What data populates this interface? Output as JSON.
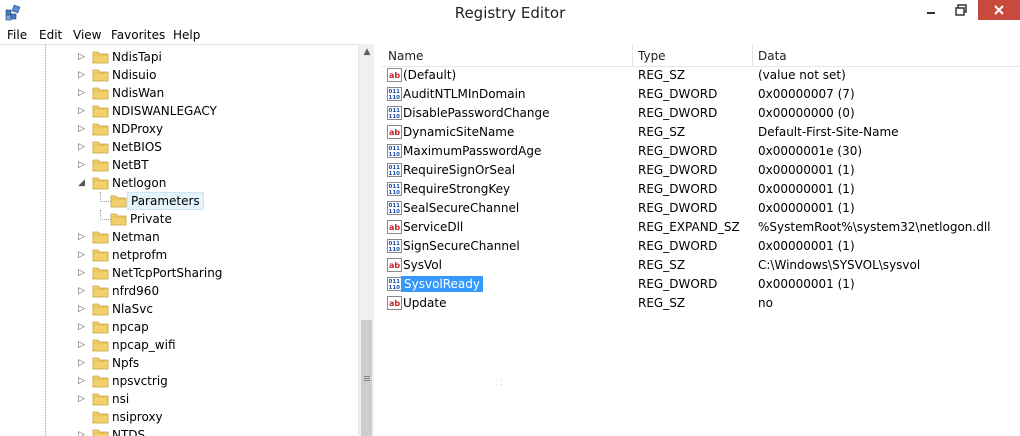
{
  "window": {
    "title": "Registry Editor"
  },
  "menu": [
    "File",
    "Edit",
    "View",
    "Favorites",
    "Help"
  ],
  "tree": [
    {
      "label": "NdisTapi",
      "expand": "▷"
    },
    {
      "label": "Ndisuio",
      "expand": "▷"
    },
    {
      "label": "NdisWan",
      "expand": "▷"
    },
    {
      "label": "NDISWANLEGACY",
      "expand": "▷"
    },
    {
      "label": "NDProxy",
      "expand": "▷"
    },
    {
      "label": "NetBIOS",
      "expand": "▷"
    },
    {
      "label": "NetBT",
      "expand": "▷"
    },
    {
      "label": "Netlogon",
      "expand": "◢"
    },
    {
      "label": "Parameters",
      "expand": "",
      "child": true,
      "selected": true
    },
    {
      "label": "Private",
      "expand": "",
      "child": true
    },
    {
      "label": "Netman",
      "expand": "▷"
    },
    {
      "label": "netprofm",
      "expand": "▷"
    },
    {
      "label": "NetTcpPortSharing",
      "expand": "▷"
    },
    {
      "label": "nfrd960",
      "expand": "▷"
    },
    {
      "label": "NlaSvc",
      "expand": "▷"
    },
    {
      "label": "npcap",
      "expand": "▷"
    },
    {
      "label": "npcap_wifi",
      "expand": "▷"
    },
    {
      "label": "Npfs",
      "expand": "▷"
    },
    {
      "label": "npsvctrig",
      "expand": "▷"
    },
    {
      "label": "nsi",
      "expand": "▷"
    },
    {
      "label": "nsiproxy",
      "expand": ""
    },
    {
      "label": "NTDS",
      "expand": "▷"
    }
  ],
  "columns": {
    "name": "Name",
    "type": "Type",
    "data": "Data"
  },
  "values": [
    {
      "name": "(Default)",
      "type": "REG_SZ",
      "data": "(value not set)",
      "icon": "string"
    },
    {
      "name": "AuditNTLMInDomain",
      "type": "REG_DWORD",
      "data": "0x00000007 (7)",
      "icon": "dword"
    },
    {
      "name": "DisablePasswordChange",
      "type": "REG_DWORD",
      "data": "0x00000000 (0)",
      "icon": "dword"
    },
    {
      "name": "DynamicSiteName",
      "type": "REG_SZ",
      "data": "Default-First-Site-Name",
      "icon": "string"
    },
    {
      "name": "MaximumPasswordAge",
      "type": "REG_DWORD",
      "data": "0x0000001e (30)",
      "icon": "dword"
    },
    {
      "name": "RequireSignOrSeal",
      "type": "REG_DWORD",
      "data": "0x00000001 (1)",
      "icon": "dword"
    },
    {
      "name": "RequireStrongKey",
      "type": "REG_DWORD",
      "data": "0x00000001 (1)",
      "icon": "dword"
    },
    {
      "name": "SealSecureChannel",
      "type": "REG_DWORD",
      "data": "0x00000001 (1)",
      "icon": "dword"
    },
    {
      "name": "ServiceDll",
      "type": "REG_EXPAND_SZ",
      "data": "%SystemRoot%\\system32\\netlogon.dll",
      "icon": "string"
    },
    {
      "name": "SignSecureChannel",
      "type": "REG_DWORD",
      "data": "0x00000001 (1)",
      "icon": "dword"
    },
    {
      "name": "SysVol",
      "type": "REG_SZ",
      "data": "C:\\Windows\\SYSVOL\\sysvol",
      "icon": "string"
    },
    {
      "name": "SysvolReady",
      "type": "REG_DWORD",
      "data": "0x00000001 (1)",
      "icon": "dword",
      "selected": true
    },
    {
      "name": "Update",
      "type": "REG_SZ",
      "data": "no",
      "icon": "string"
    }
  ],
  "colors": {
    "selection": "#3399ff",
    "close_button": "#c74a3d",
    "folder": "#e8c35a"
  }
}
